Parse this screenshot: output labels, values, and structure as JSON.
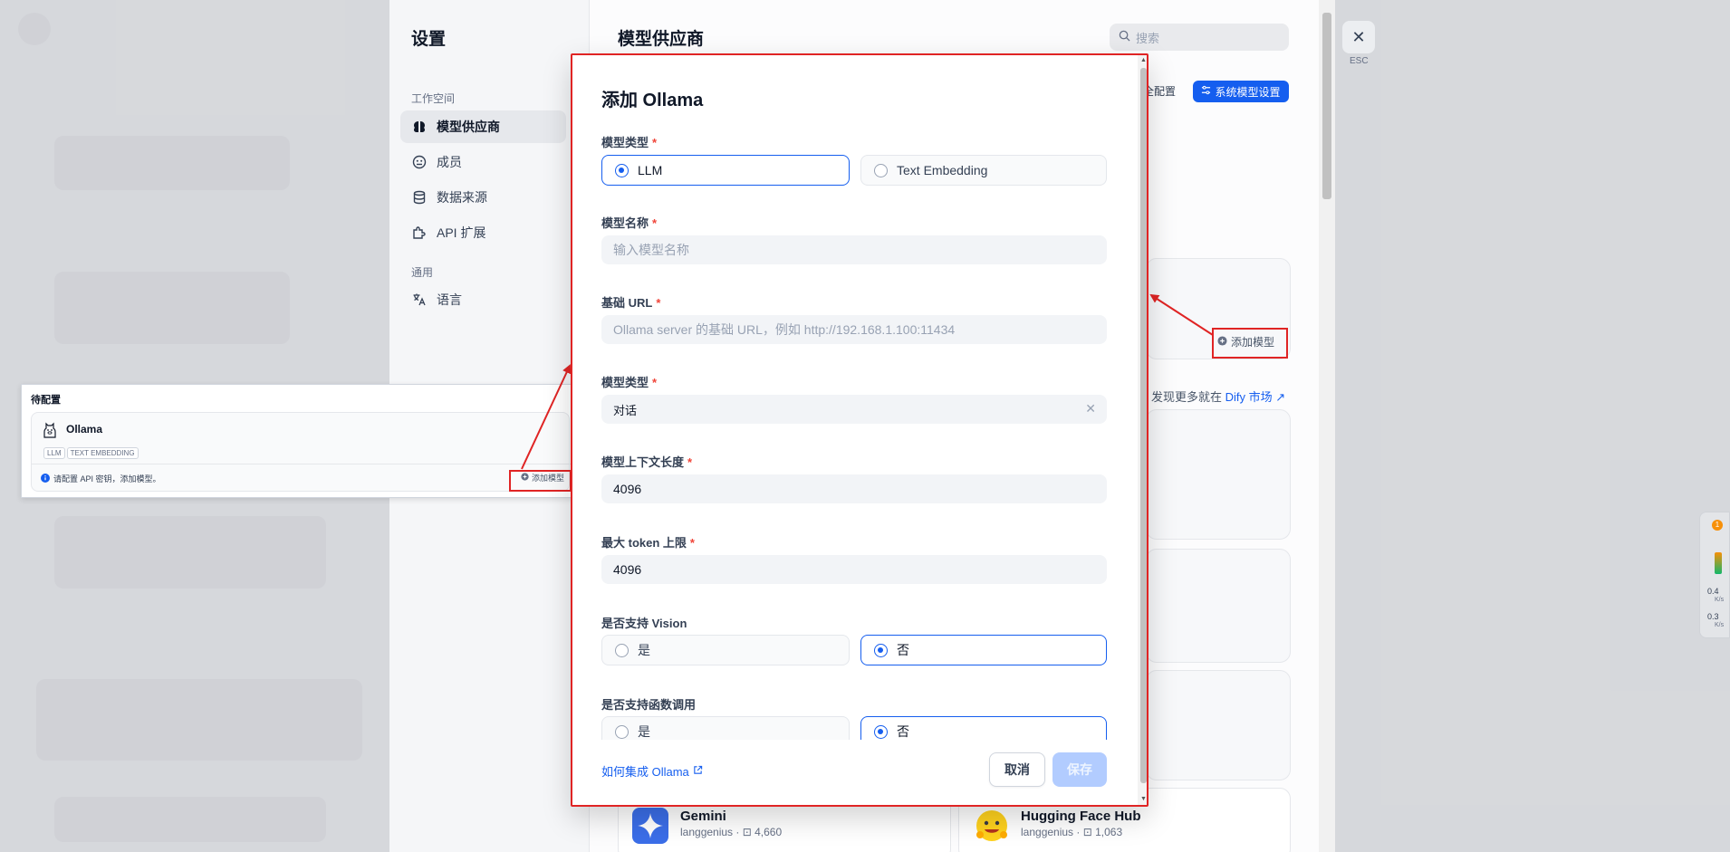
{
  "settings": {
    "title": "设置",
    "workspace_label": "工作空间",
    "general_label": "通用",
    "nav": [
      {
        "label": "模型供应商",
        "icon": "brain-icon"
      },
      {
        "label": "成员",
        "icon": "members-icon"
      },
      {
        "label": "数据来源",
        "icon": "database-icon"
      },
      {
        "label": "API 扩展",
        "icon": "puzzle-icon"
      }
    ],
    "language_label": "语言"
  },
  "main": {
    "title": "模型供应商",
    "search_placeholder": "搜索",
    "config_text": "全配置",
    "system_model_button": "系统模型设置",
    "add_model": "添加模型",
    "discover_prefix": "发现更多就在",
    "discover_link": "Dify 市场 ↗",
    "providers": [
      {
        "name": "Gemini",
        "author": "langgenius",
        "installs": "4,660"
      },
      {
        "name": "Hugging Face Hub",
        "author": "langgenius",
        "installs": "1,063"
      }
    ]
  },
  "close": {
    "esc": "ESC"
  },
  "callout": {
    "title": "待配置",
    "provider": "Ollama",
    "tags": [
      "LLM",
      "TEXT EMBEDDING"
    ],
    "hint": "请配置 API 密钥，添加模型。",
    "add_model": "添加模型"
  },
  "modal": {
    "title": "添加 Ollama",
    "model_type_label": "模型类型",
    "model_type_options": [
      "LLM",
      "Text Embedding"
    ],
    "model_type_selected": "LLM",
    "model_name_label": "模型名称",
    "model_name_placeholder": "输入模型名称",
    "base_url_label": "基础 URL",
    "base_url_placeholder": "Ollama server 的基础 URL，例如 http://192.168.1.100:11434",
    "model_kind_label": "模型类型",
    "model_kind_value": "对话",
    "context_length_label": "模型上下文长度",
    "context_length_value": "4096",
    "max_token_label": "最大 token 上限",
    "max_token_value": "4096",
    "vision_label": "是否支持 Vision",
    "vision_options": [
      "是",
      "否"
    ],
    "vision_selected": "否",
    "function_call_label": "是否支持函数调用",
    "function_call_options": [
      "是",
      "否"
    ],
    "function_call_selected": "否",
    "help_link": "如何集成 Ollama",
    "cancel": "取消",
    "save": "保存"
  },
  "net_widget": {
    "badge": "1",
    "up": "0.4",
    "up_unit": "K/s",
    "down": "0.3",
    "down_unit": "K/s"
  },
  "colors": {
    "accent": "#155eef",
    "annotation": "#e02424",
    "required": "#f04438"
  }
}
